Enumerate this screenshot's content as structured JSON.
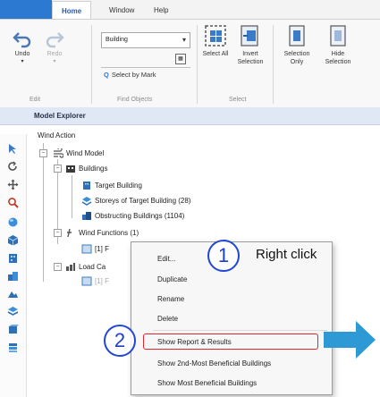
{
  "ribbon": {
    "tabs": [
      "Home",
      "Window",
      "Help"
    ],
    "undo_label": "Undo",
    "redo_label": "Redo",
    "edit_group": "Edit",
    "object_type_value": "Building",
    "select_by_mark_label": "Select by Mark",
    "find_group": "Find Objects",
    "select_all_label": "Select All",
    "invert_selection_label": "Invert Selection",
    "select_group": "Select",
    "selection_only_label": "Selection Only",
    "hide_selection_label": "Hide Selection"
  },
  "panel": {
    "title": "Model Explorer"
  },
  "tree": {
    "root": "Wind Action",
    "wind_model": "Wind Model",
    "buildings": "Buildings",
    "target_building": "Target Building",
    "storeys": "Storeys of Target Building (28)",
    "obstructing": "Obstructing Buildings (1104)",
    "wind_functions": "Wind Functions (1)",
    "function_item": "[1] F",
    "load_cases": "Load Ca",
    "load_case_item": "[1] F"
  },
  "context_menu": {
    "items": [
      "Edit...",
      "Duplicate",
      "Rename",
      "Delete",
      "Show Report & Results",
      "Show 2nd-Most Beneficial Buildings",
      "Show Most Beneficial Buildings"
    ]
  },
  "annotations": {
    "step1": "1",
    "step1_text": "Right click",
    "step2": "2",
    "highlight_color": "#e0262e",
    "callout_color": "#2147d6",
    "arrow_color": "#2d9ad6"
  }
}
